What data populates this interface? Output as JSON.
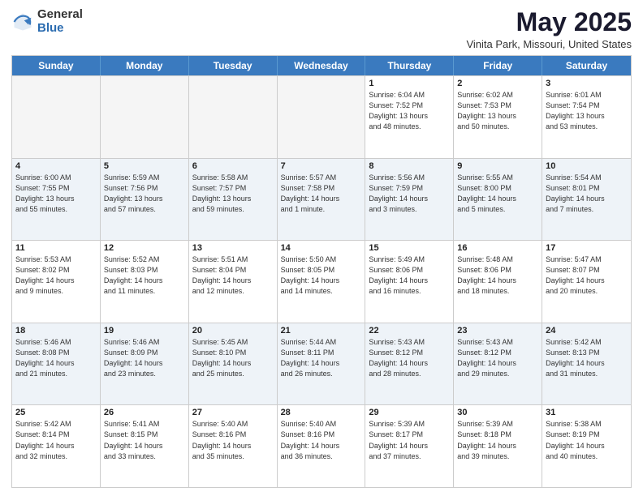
{
  "header": {
    "logo_general": "General",
    "logo_blue": "Blue",
    "month_title": "May 2025",
    "location": "Vinita Park, Missouri, United States"
  },
  "days_of_week": [
    "Sunday",
    "Monday",
    "Tuesday",
    "Wednesday",
    "Thursday",
    "Friday",
    "Saturday"
  ],
  "rows": [
    {
      "cells": [
        {
          "day": "",
          "info": "",
          "empty": true
        },
        {
          "day": "",
          "info": "",
          "empty": true
        },
        {
          "day": "",
          "info": "",
          "empty": true
        },
        {
          "day": "",
          "info": "",
          "empty": true
        },
        {
          "day": "1",
          "info": "Sunrise: 6:04 AM\nSunset: 7:52 PM\nDaylight: 13 hours\nand 48 minutes."
        },
        {
          "day": "2",
          "info": "Sunrise: 6:02 AM\nSunset: 7:53 PM\nDaylight: 13 hours\nand 50 minutes."
        },
        {
          "day": "3",
          "info": "Sunrise: 6:01 AM\nSunset: 7:54 PM\nDaylight: 13 hours\nand 53 minutes."
        }
      ]
    },
    {
      "cells": [
        {
          "day": "4",
          "info": "Sunrise: 6:00 AM\nSunset: 7:55 PM\nDaylight: 13 hours\nand 55 minutes."
        },
        {
          "day": "5",
          "info": "Sunrise: 5:59 AM\nSunset: 7:56 PM\nDaylight: 13 hours\nand 57 minutes."
        },
        {
          "day": "6",
          "info": "Sunrise: 5:58 AM\nSunset: 7:57 PM\nDaylight: 13 hours\nand 59 minutes."
        },
        {
          "day": "7",
          "info": "Sunrise: 5:57 AM\nSunset: 7:58 PM\nDaylight: 14 hours\nand 1 minute."
        },
        {
          "day": "8",
          "info": "Sunrise: 5:56 AM\nSunset: 7:59 PM\nDaylight: 14 hours\nand 3 minutes."
        },
        {
          "day": "9",
          "info": "Sunrise: 5:55 AM\nSunset: 8:00 PM\nDaylight: 14 hours\nand 5 minutes."
        },
        {
          "day": "10",
          "info": "Sunrise: 5:54 AM\nSunset: 8:01 PM\nDaylight: 14 hours\nand 7 minutes."
        }
      ]
    },
    {
      "cells": [
        {
          "day": "11",
          "info": "Sunrise: 5:53 AM\nSunset: 8:02 PM\nDaylight: 14 hours\nand 9 minutes."
        },
        {
          "day": "12",
          "info": "Sunrise: 5:52 AM\nSunset: 8:03 PM\nDaylight: 14 hours\nand 11 minutes."
        },
        {
          "day": "13",
          "info": "Sunrise: 5:51 AM\nSunset: 8:04 PM\nDaylight: 14 hours\nand 12 minutes."
        },
        {
          "day": "14",
          "info": "Sunrise: 5:50 AM\nSunset: 8:05 PM\nDaylight: 14 hours\nand 14 minutes."
        },
        {
          "day": "15",
          "info": "Sunrise: 5:49 AM\nSunset: 8:06 PM\nDaylight: 14 hours\nand 16 minutes."
        },
        {
          "day": "16",
          "info": "Sunrise: 5:48 AM\nSunset: 8:06 PM\nDaylight: 14 hours\nand 18 minutes."
        },
        {
          "day": "17",
          "info": "Sunrise: 5:47 AM\nSunset: 8:07 PM\nDaylight: 14 hours\nand 20 minutes."
        }
      ]
    },
    {
      "cells": [
        {
          "day": "18",
          "info": "Sunrise: 5:46 AM\nSunset: 8:08 PM\nDaylight: 14 hours\nand 21 minutes."
        },
        {
          "day": "19",
          "info": "Sunrise: 5:46 AM\nSunset: 8:09 PM\nDaylight: 14 hours\nand 23 minutes."
        },
        {
          "day": "20",
          "info": "Sunrise: 5:45 AM\nSunset: 8:10 PM\nDaylight: 14 hours\nand 25 minutes."
        },
        {
          "day": "21",
          "info": "Sunrise: 5:44 AM\nSunset: 8:11 PM\nDaylight: 14 hours\nand 26 minutes."
        },
        {
          "day": "22",
          "info": "Sunrise: 5:43 AM\nSunset: 8:12 PM\nDaylight: 14 hours\nand 28 minutes."
        },
        {
          "day": "23",
          "info": "Sunrise: 5:43 AM\nSunset: 8:12 PM\nDaylight: 14 hours\nand 29 minutes."
        },
        {
          "day": "24",
          "info": "Sunrise: 5:42 AM\nSunset: 8:13 PM\nDaylight: 14 hours\nand 31 minutes."
        }
      ]
    },
    {
      "cells": [
        {
          "day": "25",
          "info": "Sunrise: 5:42 AM\nSunset: 8:14 PM\nDaylight: 14 hours\nand 32 minutes."
        },
        {
          "day": "26",
          "info": "Sunrise: 5:41 AM\nSunset: 8:15 PM\nDaylight: 14 hours\nand 33 minutes."
        },
        {
          "day": "27",
          "info": "Sunrise: 5:40 AM\nSunset: 8:16 PM\nDaylight: 14 hours\nand 35 minutes."
        },
        {
          "day": "28",
          "info": "Sunrise: 5:40 AM\nSunset: 8:16 PM\nDaylight: 14 hours\nand 36 minutes."
        },
        {
          "day": "29",
          "info": "Sunrise: 5:39 AM\nSunset: 8:17 PM\nDaylight: 14 hours\nand 37 minutes."
        },
        {
          "day": "30",
          "info": "Sunrise: 5:39 AM\nSunset: 8:18 PM\nDaylight: 14 hours\nand 39 minutes."
        },
        {
          "day": "31",
          "info": "Sunrise: 5:38 AM\nSunset: 8:19 PM\nDaylight: 14 hours\nand 40 minutes."
        }
      ]
    }
  ]
}
